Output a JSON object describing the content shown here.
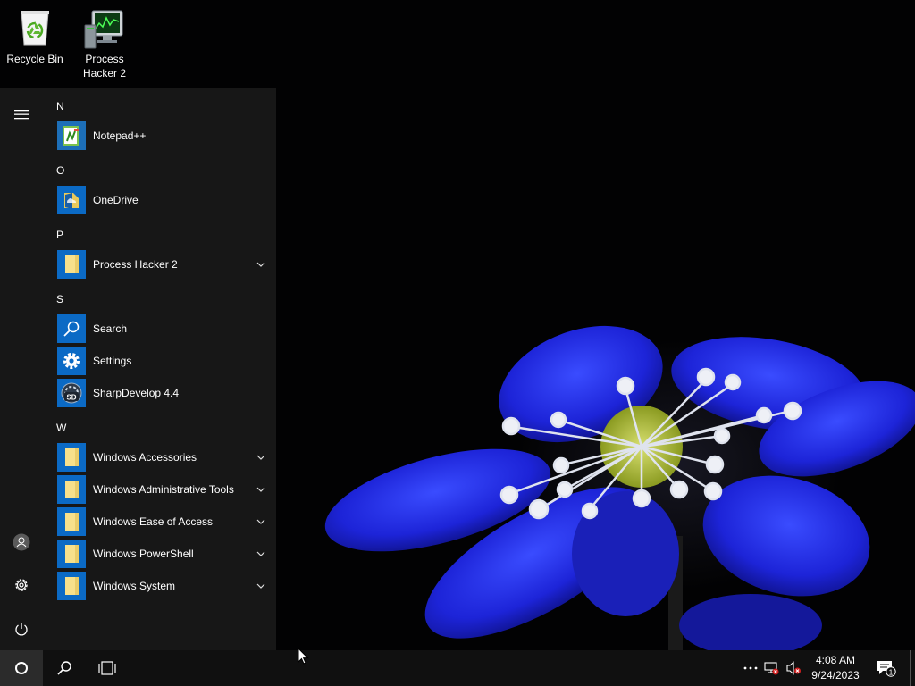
{
  "desktop": {
    "icons": [
      {
        "label": "Recycle Bin",
        "icon": "recycle-bin-icon"
      },
      {
        "label": "Process\nHacker 2",
        "icon": "process-hacker-icon"
      }
    ]
  },
  "start_menu": {
    "rail": {
      "hamburger": "hamburger-menu-icon",
      "user": "user-account-icon",
      "settings": "gear-icon",
      "power": "power-icon"
    },
    "groups": [
      {
        "letter": "N",
        "apps": [
          {
            "label": "Notepad++",
            "icon": "notepad-plus-plus-icon",
            "expandable": false
          }
        ]
      },
      {
        "letter": "O",
        "apps": [
          {
            "label": "OneDrive",
            "icon": "onedrive-icon",
            "expandable": false
          }
        ]
      },
      {
        "letter": "P",
        "apps": [
          {
            "label": "Process Hacker 2",
            "icon": "folder-icon",
            "expandable": true
          }
        ]
      },
      {
        "letter": "S",
        "apps": [
          {
            "label": "Search",
            "icon": "search-icon",
            "expandable": false
          },
          {
            "label": "Settings",
            "icon": "gear-icon",
            "expandable": false
          },
          {
            "label": "SharpDevelop 4.4",
            "icon": "sharpdevelop-icon",
            "expandable": false
          }
        ]
      },
      {
        "letter": "W",
        "apps": [
          {
            "label": "Windows Accessories",
            "icon": "folder-icon",
            "expandable": true
          },
          {
            "label": "Windows Administrative Tools",
            "icon": "folder-icon",
            "expandable": true
          },
          {
            "label": "Windows Ease of Access",
            "icon": "folder-icon",
            "expandable": true
          },
          {
            "label": "Windows PowerShell",
            "icon": "folder-icon",
            "expandable": true
          },
          {
            "label": "Windows System",
            "icon": "folder-icon",
            "expandable": true
          }
        ]
      }
    ]
  },
  "taskbar": {
    "clock": {
      "time": "4:08 AM",
      "date": "9/24/2023"
    },
    "notification_count": "1",
    "tray_icons": [
      "overflow-dots-icon",
      "network-disconnected-icon",
      "volume-muted-icon"
    ]
  },
  "colors": {
    "accent": "#0b6ac5",
    "folder": "#f7e08b",
    "start_bg": "#181818",
    "taskbar_bg": "#101010"
  }
}
